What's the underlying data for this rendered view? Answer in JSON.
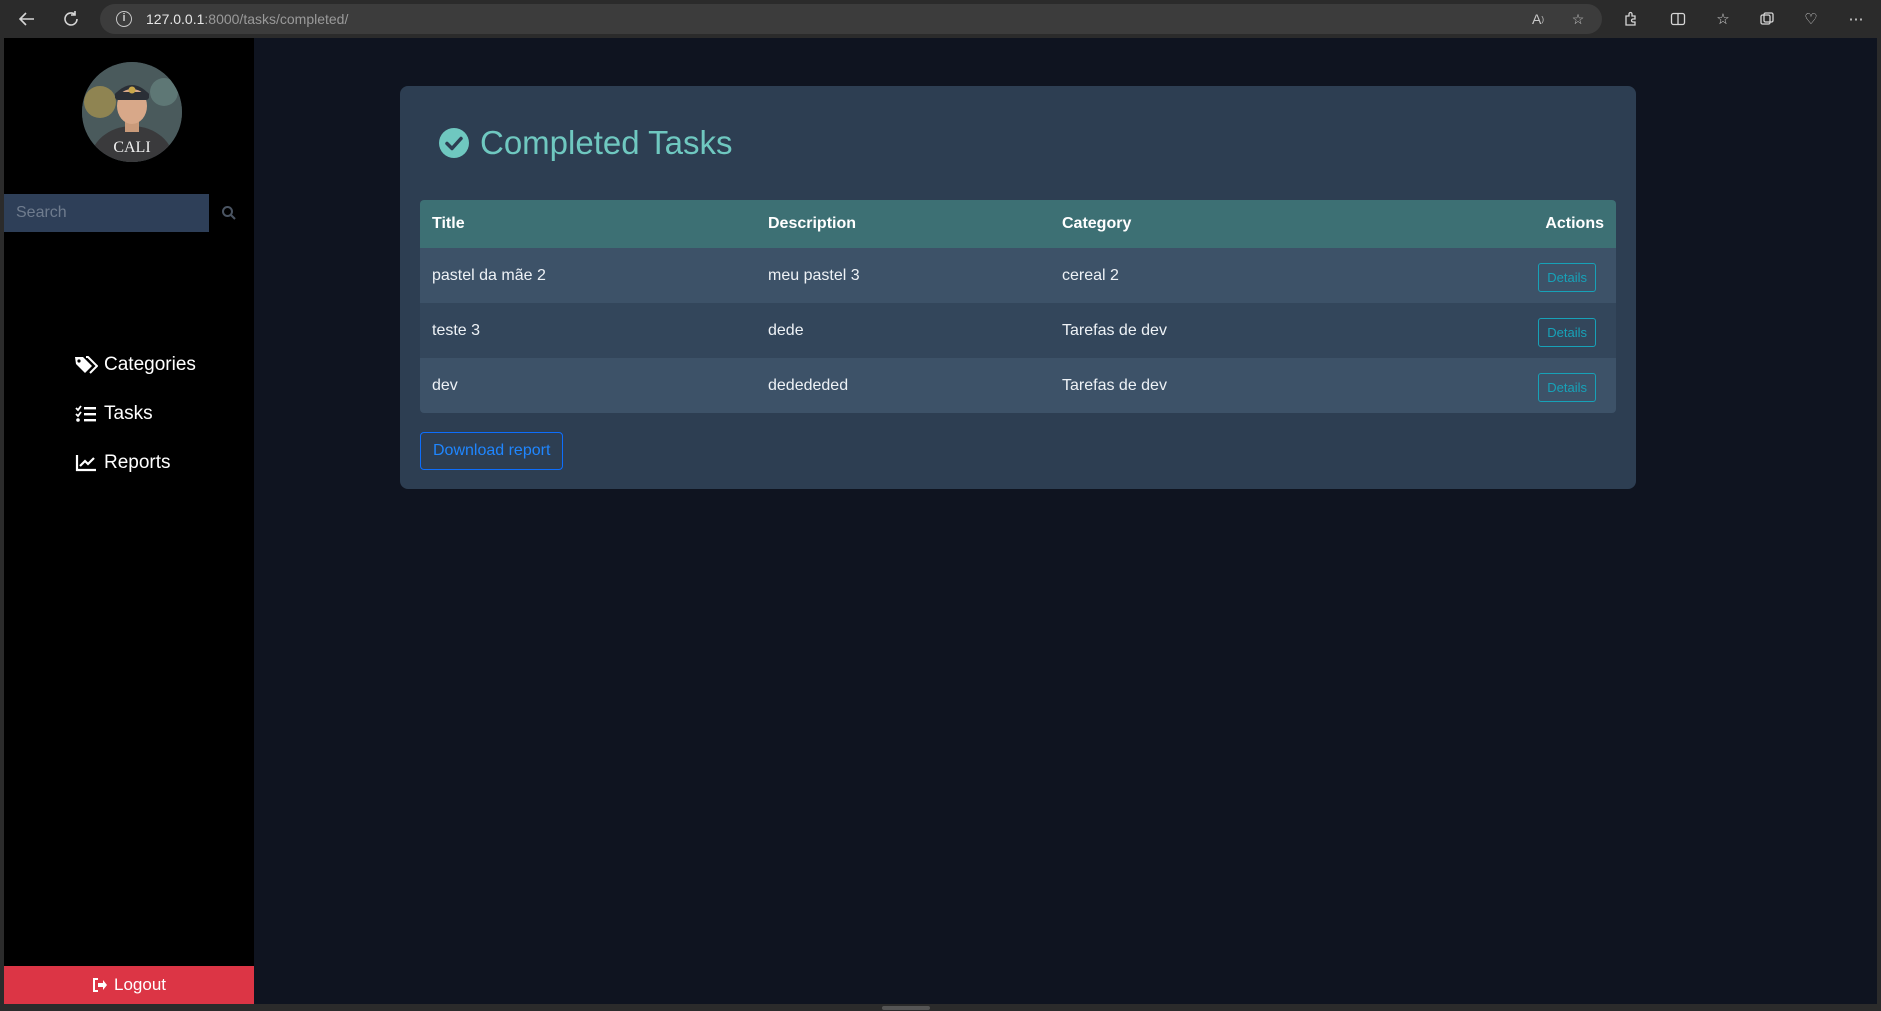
{
  "browser": {
    "url_host": "127.0.0.1",
    "url_rest": ":8000/tasks/completed/"
  },
  "sidebar": {
    "search_placeholder": "Search",
    "nav": [
      {
        "label": "Categories",
        "icon": "tags-icon"
      },
      {
        "label": "Tasks",
        "icon": "list-check-icon"
      },
      {
        "label": "Reports",
        "icon": "chart-line-icon"
      }
    ],
    "logout_label": "Logout",
    "avatar_shirt_text": "CALI"
  },
  "main": {
    "title": "Completed Tasks",
    "table": {
      "headers": {
        "title": "Title",
        "description": "Description",
        "category": "Category",
        "actions": "Actions"
      },
      "rows": [
        {
          "title": "pastel da mãe 2",
          "description": "meu pastel 3",
          "category": "cereal 2",
          "action": "Details"
        },
        {
          "title": "teste 3",
          "description": "dede",
          "category": "Tarefas de dev",
          "action": "Details"
        },
        {
          "title": "dev",
          "description": "dedededed",
          "category": "Tarefas de dev",
          "action": "Details"
        }
      ]
    },
    "download_label": "Download report"
  },
  "colors": {
    "title_accent": "#6fc8c0",
    "table_header": "#3d7074",
    "logout": "#dc3545",
    "details_outline": "#17a2b8",
    "download_outline": "#0d6efd"
  }
}
